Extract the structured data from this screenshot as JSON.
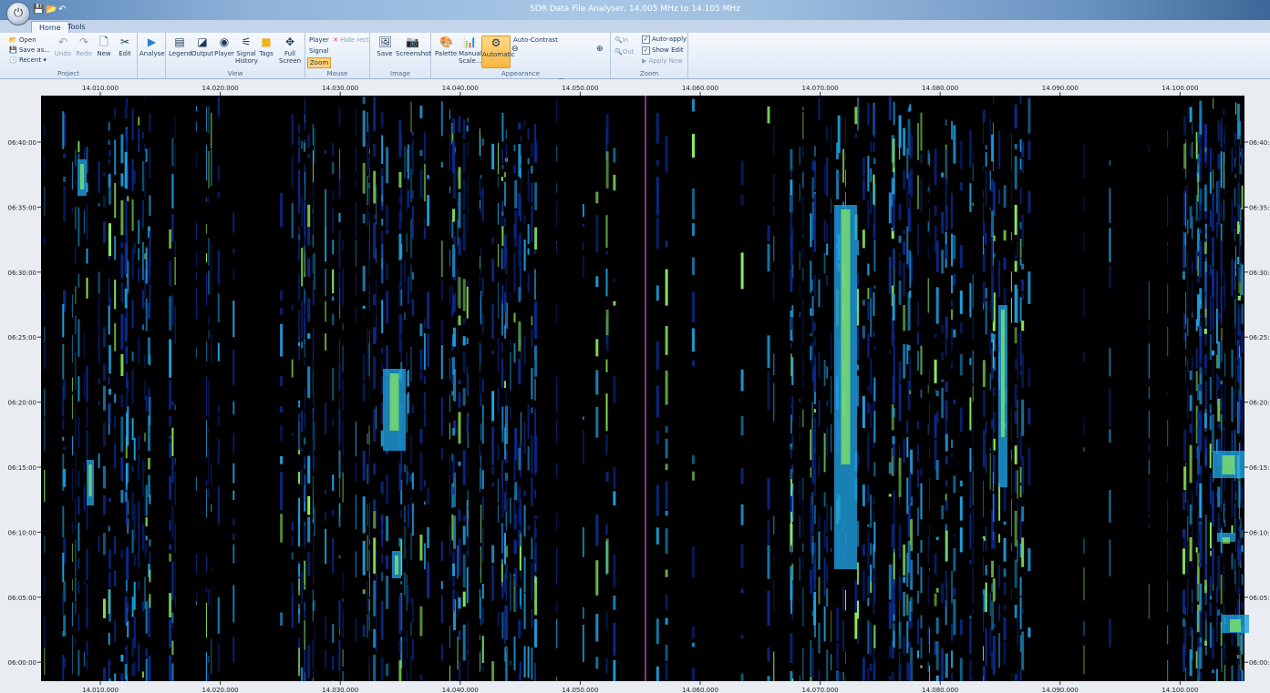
{
  "window": {
    "title": "SDR Data File Analyser, 14.005 MHz to 14.105 MHz"
  },
  "tabs": [
    {
      "label": "Home",
      "active": true
    },
    {
      "label": "Tools",
      "active": false
    }
  ],
  "ribbon": {
    "project": {
      "label": "Project",
      "open": "Open",
      "save_as": "Save as...",
      "recent": "Recent",
      "undo": "Undo",
      "redo": "Redo",
      "new": "New",
      "edit": "Edit"
    },
    "analyse": {
      "label": "Analyse"
    },
    "view": {
      "label": "View",
      "legend": "Legend",
      "output": "Output",
      "player": "Player",
      "signal_history": "Signal History",
      "tags": "Tags",
      "full_screen": "Full Screen"
    },
    "mouse": {
      "label": "Mouse",
      "player": "Player",
      "hide_rect": "Hide rect",
      "signal": "Signal",
      "zoom": "Zoom"
    },
    "image": {
      "label": "Image",
      "save": "Save",
      "screenshot": "Screenshot"
    },
    "appearance": {
      "label": "Appearance",
      "palette": "Palette",
      "manual_scale": "Manual Scale...",
      "automatic": "Automatic",
      "auto_contrast": "Auto-Contrast"
    },
    "zoom": {
      "label": "Zoom",
      "in": "In",
      "out": "Out",
      "auto_apply": "Auto-apply",
      "show_edit": "Show Edit",
      "apply_now": "Apply Now"
    }
  },
  "waterfall": {
    "freq_ticks": [
      "14.010.000",
      "14.020.000",
      "14.030.000",
      "14.040.000",
      "14.050.000",
      "14.060.000",
      "14.070.000",
      "14.080.000",
      "14.090.000",
      "14.100.000"
    ],
    "time_ticks": [
      "06:40:00",
      "06:35:00",
      "06:30:00",
      "06:25:00",
      "06:20:00",
      "06:15:00",
      "06:10:00",
      "06:05:00",
      "06:00:00"
    ],
    "colors": {
      "background": "#000000",
      "signal_low": "#0b2a8c",
      "signal_mid": "#1fa0e0",
      "signal_high": "#8ff060",
      "marker": "#c040c0"
    }
  }
}
